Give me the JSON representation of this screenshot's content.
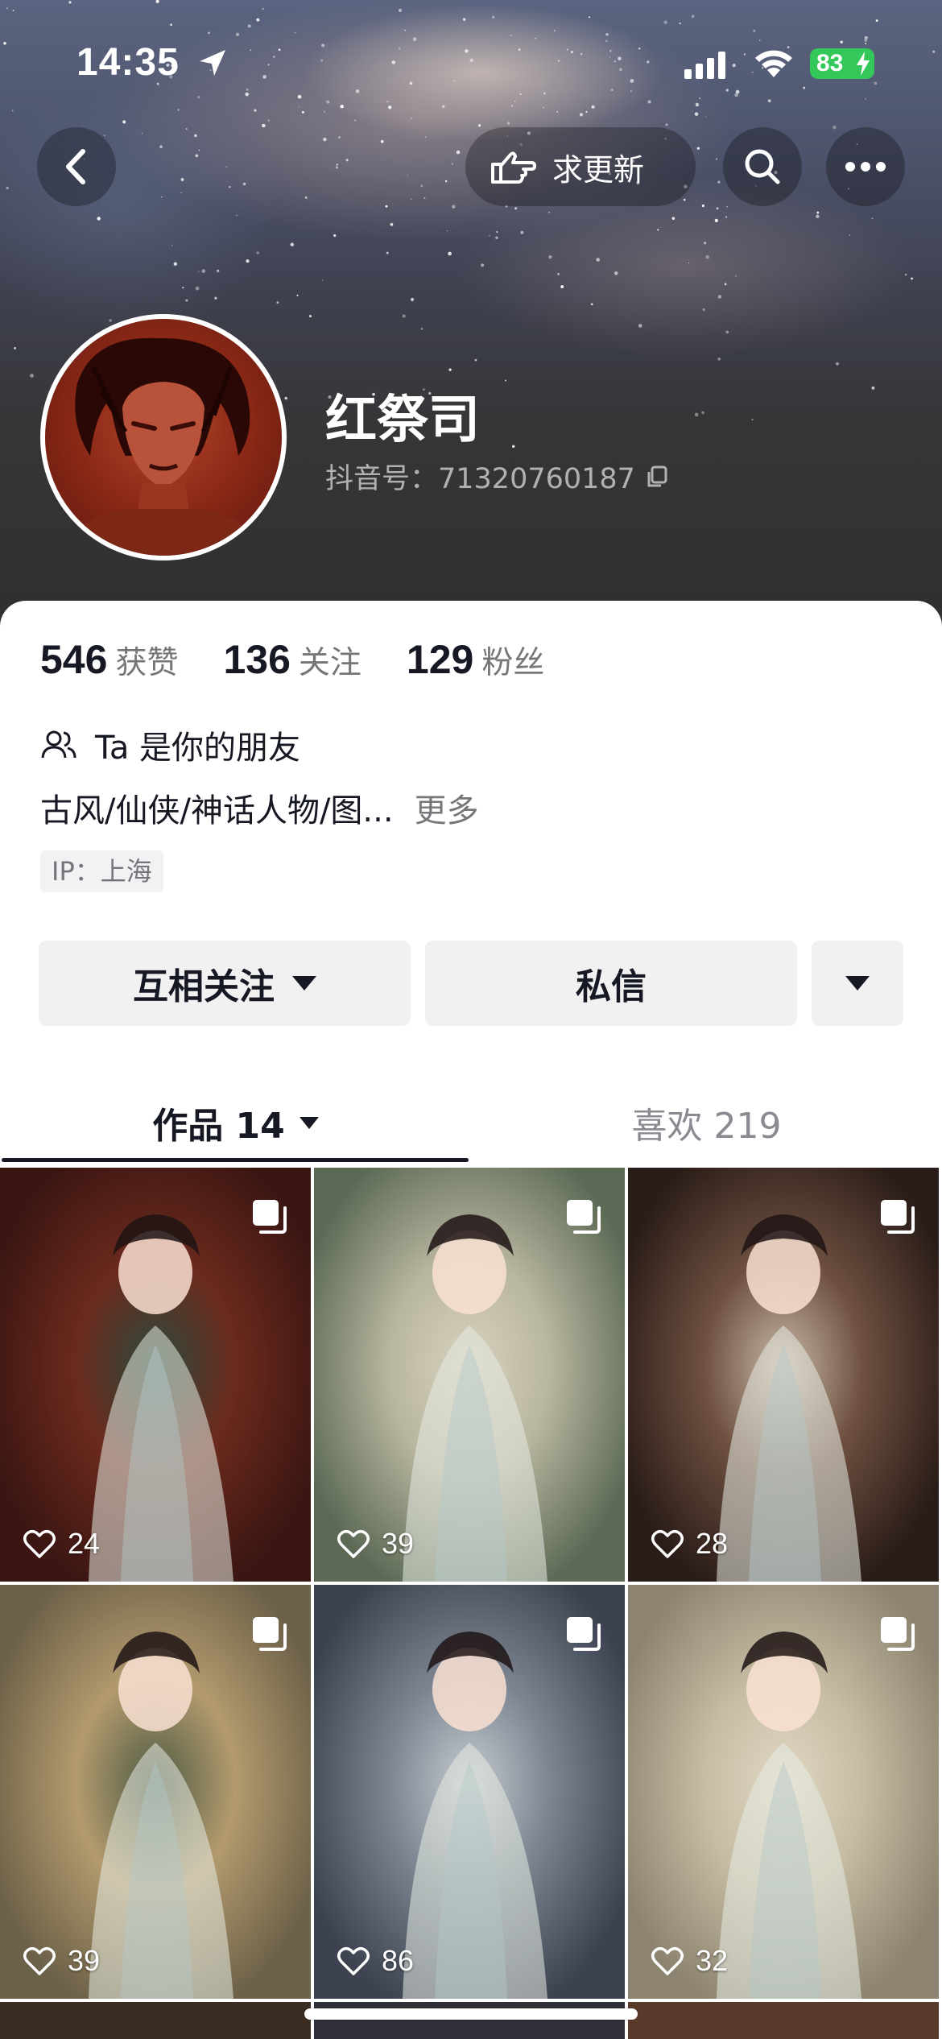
{
  "status_bar": {
    "time": "14:35",
    "battery": "83"
  },
  "header": {
    "request_update_label": "求更新",
    "icons": [
      "back-arrow-icon",
      "pointing-hand-icon",
      "search-icon",
      "more-icon"
    ]
  },
  "profile": {
    "name": "红祭司",
    "douyin_id": "抖音号：71320760187",
    "stats": [
      {
        "num": "546",
        "label": "获赞"
      },
      {
        "num": "136",
        "label": "关注"
      },
      {
        "num": "129",
        "label": "粉丝"
      }
    ],
    "friend_text": "Ta 是你的朋友",
    "bio": "古风/仙侠/神话人物/图...",
    "bio_more": "更多",
    "ip": "IP：上海"
  },
  "actions": {
    "follow_label": "互相关注",
    "message_label": "私信"
  },
  "tabs": [
    {
      "label": "作品 14"
    },
    {
      "label": "喜欢 219"
    }
  ],
  "grid": {
    "tiles": [
      {
        "likes": "24",
        "bg": [
          "#3a1512",
          "#6b2a1d",
          "#2b4a3c"
        ]
      },
      {
        "likes": "39",
        "bg": [
          "#5c6a55",
          "#b9b6a0",
          "#d8d2be"
        ]
      },
      {
        "likes": "28",
        "bg": [
          "#2a1c18",
          "#6e5040",
          "#c8b8a6"
        ]
      },
      {
        "likes": "39",
        "bg": [
          "#6b6048",
          "#b39a6e",
          "#4e5b44"
        ]
      },
      {
        "likes": "86",
        "bg": [
          "#3c4250",
          "#7d8692",
          "#c6cbd0"
        ]
      },
      {
        "likes": "32",
        "bg": [
          "#8c8470",
          "#c6bca3",
          "#e1d8c4"
        ]
      }
    ]
  }
}
